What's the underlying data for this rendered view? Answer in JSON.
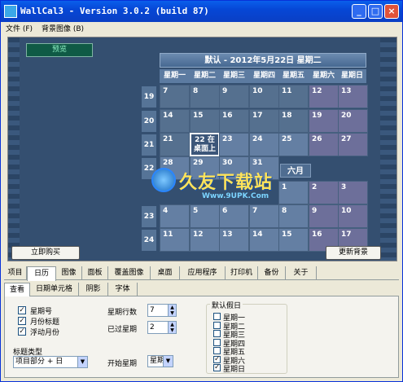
{
  "window": {
    "title": "WallCal3 - Version 3.0.2 (build 87)",
    "min_label": "_",
    "max_label": "□",
    "close_label": "×"
  },
  "menu": {
    "file": "文件 (F)",
    "background": "背景图像 (B)"
  },
  "preview": {
    "label": "预览",
    "cal_title": "默认 - 2012年5月22日 星期二",
    "weekdays": [
      "星期一",
      "星期二",
      "星期三",
      "星期四",
      "星期五",
      "星期六",
      "星期日"
    ],
    "weeks": [
      "19",
      "20",
      "21",
      "22",
      "23",
      "24"
    ],
    "may_rows": [
      [
        "7",
        "8",
        "9",
        "10",
        "11",
        "12",
        "13"
      ],
      [
        "14",
        "15",
        "16",
        "17",
        "18",
        "19",
        "20"
      ],
      [
        "21",
        "22 在\n桌面上",
        "23",
        "24",
        "25",
        "26",
        "27"
      ],
      [
        "28",
        "29",
        "30",
        "31",
        "",
        "",
        ""
      ]
    ],
    "june_label": "六月",
    "june_rows": [
      [
        "",
        "",
        "",
        "",
        "1",
        "2",
        "3"
      ],
      [
        "4",
        "5",
        "6",
        "7",
        "8",
        "9",
        "10"
      ],
      [
        "11",
        "12",
        "13",
        "14",
        "15",
        "16",
        "17"
      ]
    ],
    "watermark": "久友下载站",
    "watermark_url": "Www.9UPK.Com",
    "buy_button": "立即购买",
    "update_button": "更新背景"
  },
  "tabs_main": [
    "项目",
    "日历",
    "图像",
    "面板",
    "覆盖图像",
    "桌面",
    "应用程序",
    "打印机",
    "备份",
    "关于"
  ],
  "tabs_main_active": "日历",
  "tabs_sub": [
    "查看",
    "日期单元格",
    "阴影",
    "字体"
  ],
  "tabs_sub_active": "查看",
  "view": {
    "checks": [
      {
        "label": "星期号",
        "checked": true
      },
      {
        "label": "月份标题",
        "checked": true
      },
      {
        "label": "浮动月份",
        "checked": true
      }
    ],
    "title_type_label": "标题类型",
    "title_type_value": "项目部分 + 日",
    "week_rows_label": "星期行数",
    "week_rows_value": "7",
    "past_weeks_label": "已过星期",
    "past_weeks_value": "2",
    "start_week_label": "开始星期",
    "start_week_value": "星期",
    "holiday_legend": "默认假日",
    "holidays": [
      {
        "label": "星期一",
        "checked": false
      },
      {
        "label": "星期二",
        "checked": false
      },
      {
        "label": "星期三",
        "checked": false
      },
      {
        "label": "星期四",
        "checked": false
      },
      {
        "label": "星期五",
        "checked": false
      },
      {
        "label": "星期六",
        "checked": true
      },
      {
        "label": "星期日",
        "checked": true
      }
    ]
  },
  "colors": {
    "titlebar": "#0A5FEB",
    "preview_bg": "#344F70",
    "cell": "#647FA3"
  }
}
